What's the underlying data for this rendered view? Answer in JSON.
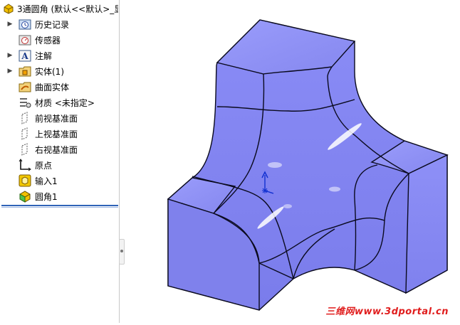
{
  "tree": {
    "root_label": "3通圆角 (默认<<默认>_显",
    "items": [
      {
        "label": "历史记录",
        "icon": "history-icon",
        "expandable": true
      },
      {
        "label": "传感器",
        "icon": "sensor-icon",
        "expandable": false
      },
      {
        "label": "注解",
        "icon": "annotation-icon",
        "expandable": true
      },
      {
        "label": "实体(1)",
        "icon": "solid-bodies-icon",
        "expandable": true
      },
      {
        "label": "曲面实体",
        "icon": "surface-bodies-icon",
        "expandable": false
      },
      {
        "label": "材质 <未指定>",
        "icon": "material-icon",
        "expandable": false
      },
      {
        "label": "前视基准面",
        "icon": "plane-icon",
        "expandable": false
      },
      {
        "label": "上视基准面",
        "icon": "plane-icon",
        "expandable": false
      },
      {
        "label": "右视基准面",
        "icon": "plane-icon",
        "expandable": false
      },
      {
        "label": "原点",
        "icon": "origin-icon",
        "expandable": false
      },
      {
        "label": "输入1",
        "icon": "imported-feature-icon",
        "expandable": false
      },
      {
        "label": "圆角1",
        "icon": "fillet-feature-icon",
        "expandable": false
      }
    ]
  },
  "watermark": "三维网www.3dportal.cn",
  "colors": {
    "model_face": "#8d8ff5",
    "model_edge": "#0a0a1e",
    "tree_rule": "#2f63b8",
    "watermark": "#e01d1d"
  }
}
